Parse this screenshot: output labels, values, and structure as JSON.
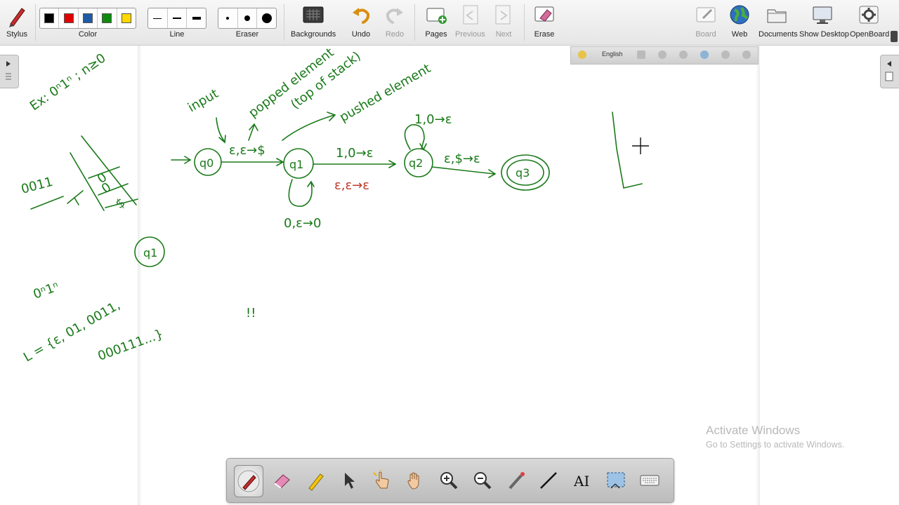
{
  "toolbar": {
    "stylus": "Stylus",
    "color": "Color",
    "line": "Line",
    "eraser": "Eraser",
    "backgrounds": "Backgrounds",
    "undo": "Undo",
    "redo": "Redo",
    "pages": "Pages",
    "previous": "Previous",
    "next": "Next",
    "erase": "Erase",
    "board": "Board",
    "web": "Web",
    "documents": "Documents",
    "show_desktop": "Show Desktop",
    "openboard": "OpenBoard",
    "colors": [
      "#000000",
      "#e00000",
      "#1f5aa6",
      "#0f8a0f",
      "#ffd800"
    ]
  },
  "keyboard_bar": {
    "language": "English"
  },
  "board": {
    "ink_color": "#1a7a1a",
    "ink_red": "#c0392b",
    "notes": {
      "example": "Ex: 0ⁿ1ⁿ ; n≥0",
      "input": "input",
      "popped": "popped element",
      "top_of_stack": "(top of stack)",
      "pushed": "pushed element",
      "t01": "ε,ε→$",
      "t12": "1,0→ε",
      "t12_red": "ε,ε→ε",
      "t11": "0,ε→0",
      "t22": "1,0→ε",
      "t23": "ε,$→ε",
      "q0": "q0",
      "q1": "q1",
      "q2": "q2",
      "q3": "q3",
      "input_str": "0011",
      "stack_0": "0",
      "stack_0b": "0",
      "stack_dollar": "$",
      "q1_circle": "q1",
      "lang_head": "0ⁿ1ⁿ",
      "lang_set": "L = {ε, 01, 0011,",
      "lang_set2": "000111...}",
      "exclaim": "!!"
    }
  },
  "watermark": {
    "title": "Activate Windows",
    "subtitle": "Go to Settings to activate Windows."
  }
}
